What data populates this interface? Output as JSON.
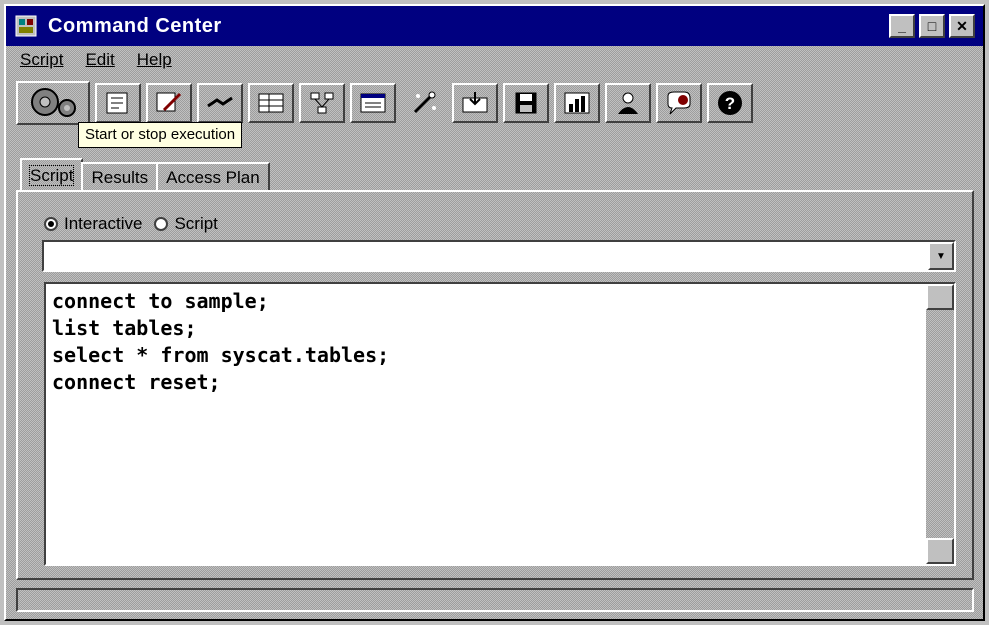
{
  "window": {
    "title": "Command Center",
    "controls": [
      "minimize",
      "maximize",
      "close"
    ]
  },
  "menu": [
    "Script",
    "Edit",
    "Help"
  ],
  "toolbar": {
    "tooltip": "Start or stop execution",
    "buttons": [
      "start-stop-execution-icon",
      "script-icon",
      "edit-icon",
      "connect-icon",
      "table-icon",
      "access-plan-icon",
      "results-icon",
      "wand-icon",
      "import-icon",
      "save-icon",
      "chart-icon",
      "user-icon",
      "help-balloon-icon",
      "question-icon"
    ]
  },
  "tabs": [
    "Script",
    "Results",
    "Access Plan"
  ],
  "mode": {
    "options": [
      "Interactive",
      "Script"
    ],
    "selected": "Interactive"
  },
  "command_input": {
    "value": ""
  },
  "editor": {
    "lines": [
      "connect to sample;",
      "list tables;",
      "select * from syscat.tables;",
      "connect reset;"
    ]
  }
}
